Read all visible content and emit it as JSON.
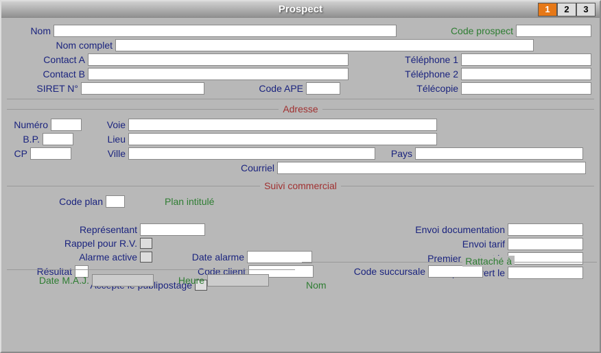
{
  "window": {
    "title": "Prospect"
  },
  "tabs": {
    "t1": "1",
    "t2": "2",
    "t3": "3"
  },
  "top": {
    "nom": "Nom",
    "code_prospect": "Code prospect",
    "nom_complet": "Nom complet",
    "contact_a": "Contact A",
    "telephone1": "Téléphone 1",
    "contact_b": "Contact B",
    "telephone2": "Téléphone 2",
    "siret": "SIRET N°",
    "code_ape": "Code APE",
    "telecopie": "Télécopie"
  },
  "adresse": {
    "section": "Adresse",
    "numero": "Numéro",
    "voie": "Voie",
    "bp": "B.P.",
    "lieu": "Lieu",
    "cp": "CP",
    "ville": "Ville",
    "pays": "Pays",
    "courriel": "Courriel"
  },
  "suivi": {
    "section": "Suivi commercial",
    "code_plan": "Code plan",
    "plan_intitule": "Plan intitulé",
    "representant": "Représentant",
    "rappel_rv": "Rappel pour R.V.",
    "alarme_active": "Alarme active",
    "date_alarme": "Date alarme",
    "resultat": "Résultat",
    "code_client": "Code client",
    "publipostage": "Accepte le publipostage",
    "envoi_doc": "Envoi documentation",
    "envoi_tarif": "Envoi tarif",
    "premier_contact": "Premier contact le",
    "compte_ouvert": "Compte ouvert le"
  },
  "rattache": {
    "section": "Rattaché à",
    "code_succursale": "Code succursale",
    "nom": "Nom"
  },
  "footer": {
    "date_maj": "Date M.A.J.",
    "heure": "Heure"
  }
}
